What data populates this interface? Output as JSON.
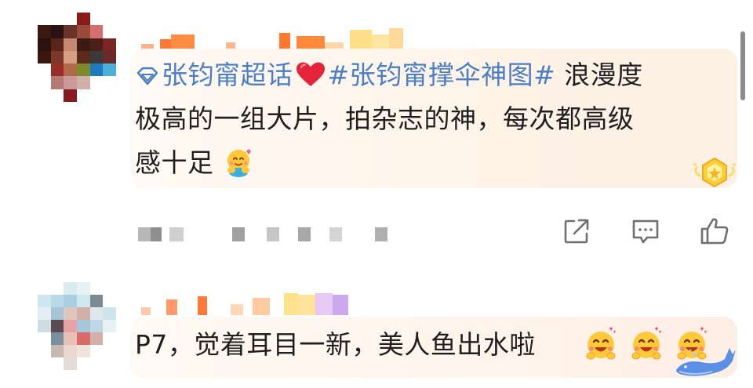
{
  "comments": [
    {
      "topic_super": "张钧甯超话",
      "topic_hashtag": "#张钧甯撑伞神图#",
      "body_line1": " 浪漫度",
      "body_line2": "极高的一组大片，拍杂志的神，每次都高级",
      "body_line3": "感十足",
      "icons": [
        "diamond-icon",
        "heart-emoji",
        "hug-emoji",
        "vip-badge-icon"
      ]
    },
    {
      "body": "P7，觉着耳目一新，美人鱼出水啦",
      "icons": [
        "laugh-emoji",
        "laugh-emoji",
        "laugh-emoji",
        "whale-icon"
      ]
    }
  ],
  "actions": [
    {
      "name": "share",
      "icon": "share-icon"
    },
    {
      "name": "reply",
      "icon": "comment-icon"
    },
    {
      "name": "like",
      "icon": "thumbs-up-icon"
    }
  ],
  "colors": {
    "topic": "#4a7ec6",
    "text": "#1f1f1f",
    "card_bg": "#fff5ec",
    "icon_gray": "#6f6f6f"
  }
}
